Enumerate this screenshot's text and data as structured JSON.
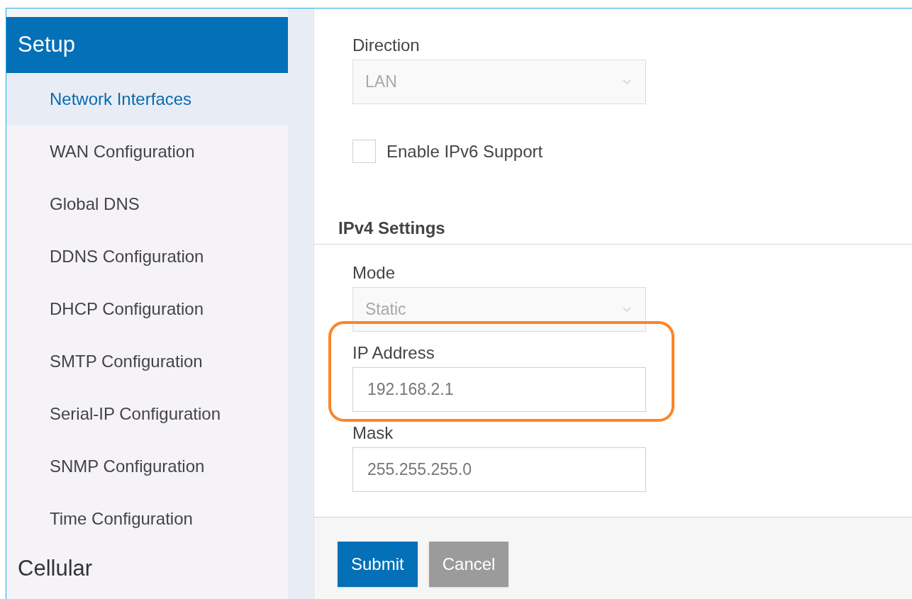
{
  "sidebar": {
    "sections": [
      {
        "title": "Setup",
        "expanded": true,
        "items": [
          {
            "label": "Network Interfaces",
            "selected": true
          },
          {
            "label": "WAN Configuration",
            "selected": false
          },
          {
            "label": "Global DNS",
            "selected": false
          },
          {
            "label": "DDNS Configuration",
            "selected": false
          },
          {
            "label": "DHCP Configuration",
            "selected": false
          },
          {
            "label": "SMTP Configuration",
            "selected": false
          },
          {
            "label": "Serial-IP Configuration",
            "selected": false
          },
          {
            "label": "SNMP Configuration",
            "selected": false
          },
          {
            "label": "Time Configuration",
            "selected": false
          }
        ]
      },
      {
        "title": "Cellular",
        "expanded": false
      }
    ]
  },
  "form": {
    "fields": [
      {
        "kind": "select",
        "label": "Direction",
        "value": "LAN",
        "disabled": true
      },
      {
        "kind": "checkbox",
        "label": "Enable IPv6 Support",
        "checked": false
      },
      {
        "kind": "heading",
        "label": "IPv4 Settings"
      },
      {
        "kind": "select",
        "label": "Mode",
        "value": "Static",
        "disabled": true
      },
      {
        "kind": "text",
        "label": "IP Address",
        "value": "192.168.2.1",
        "highlighted": true
      },
      {
        "kind": "text",
        "label": "Mask",
        "value": "255.255.255.0",
        "highlighted": false
      }
    ],
    "buttons": [
      {
        "label": "Submit",
        "kind": "primary"
      },
      {
        "label": "Cancel",
        "kind": "secondary"
      }
    ]
  }
}
